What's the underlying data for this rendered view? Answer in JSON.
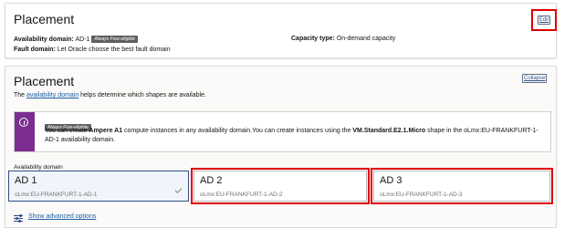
{
  "summary": {
    "title": "Placement",
    "edit_label": "Edit",
    "availability_domain_label": "Availability domain:",
    "availability_domain_value": "AD-1",
    "always_free_badge": "Always Free-eligible",
    "fault_domain_label": "Fault domain:",
    "fault_domain_value": "Let Oracle choose the best fault domain",
    "capacity_type_label": "Capacity type:",
    "capacity_type_value": "On-demand capacity"
  },
  "placement": {
    "title": "Placement",
    "collapse_label": "Collapse",
    "desc_prefix": "The ",
    "desc_link": "availability domain",
    "desc_suffix": " helps determine which shapes are available.",
    "notice": {
      "badge": "Always Free-eligible",
      "text_1": "You can create ",
      "text_bold_1": "Ampere A1",
      "text_2": " compute instances in any availability domain.You can create instances using the ",
      "text_bold_2": "VM.Standard.E2.1.Micro",
      "text_3": " shape in the oLmx:EU-FRANKFURT-1-AD-1 availability domain."
    },
    "ad_label": "Availability domain",
    "domains": [
      {
        "name": "AD 1",
        "sub": "oLmx:EU-FRANKFURT-1-AD-1",
        "selected": true
      },
      {
        "name": "AD 2",
        "sub": "oLmx:EU-FRANKFURT-1-AD-2",
        "selected": false
      },
      {
        "name": "AD 3",
        "sub": "oLmx:EU-FRANKFURT-1-AD-3",
        "selected": false
      }
    ],
    "advanced_link": "Show advanced options"
  },
  "colors": {
    "highlight": "#e00000",
    "notice_accent": "#7b2e8f",
    "link": "#1d5fa6",
    "selected_border": "#2f4f88"
  },
  "icons": [
    "info-icon",
    "checkmark-icon",
    "sliders-icon"
  ]
}
